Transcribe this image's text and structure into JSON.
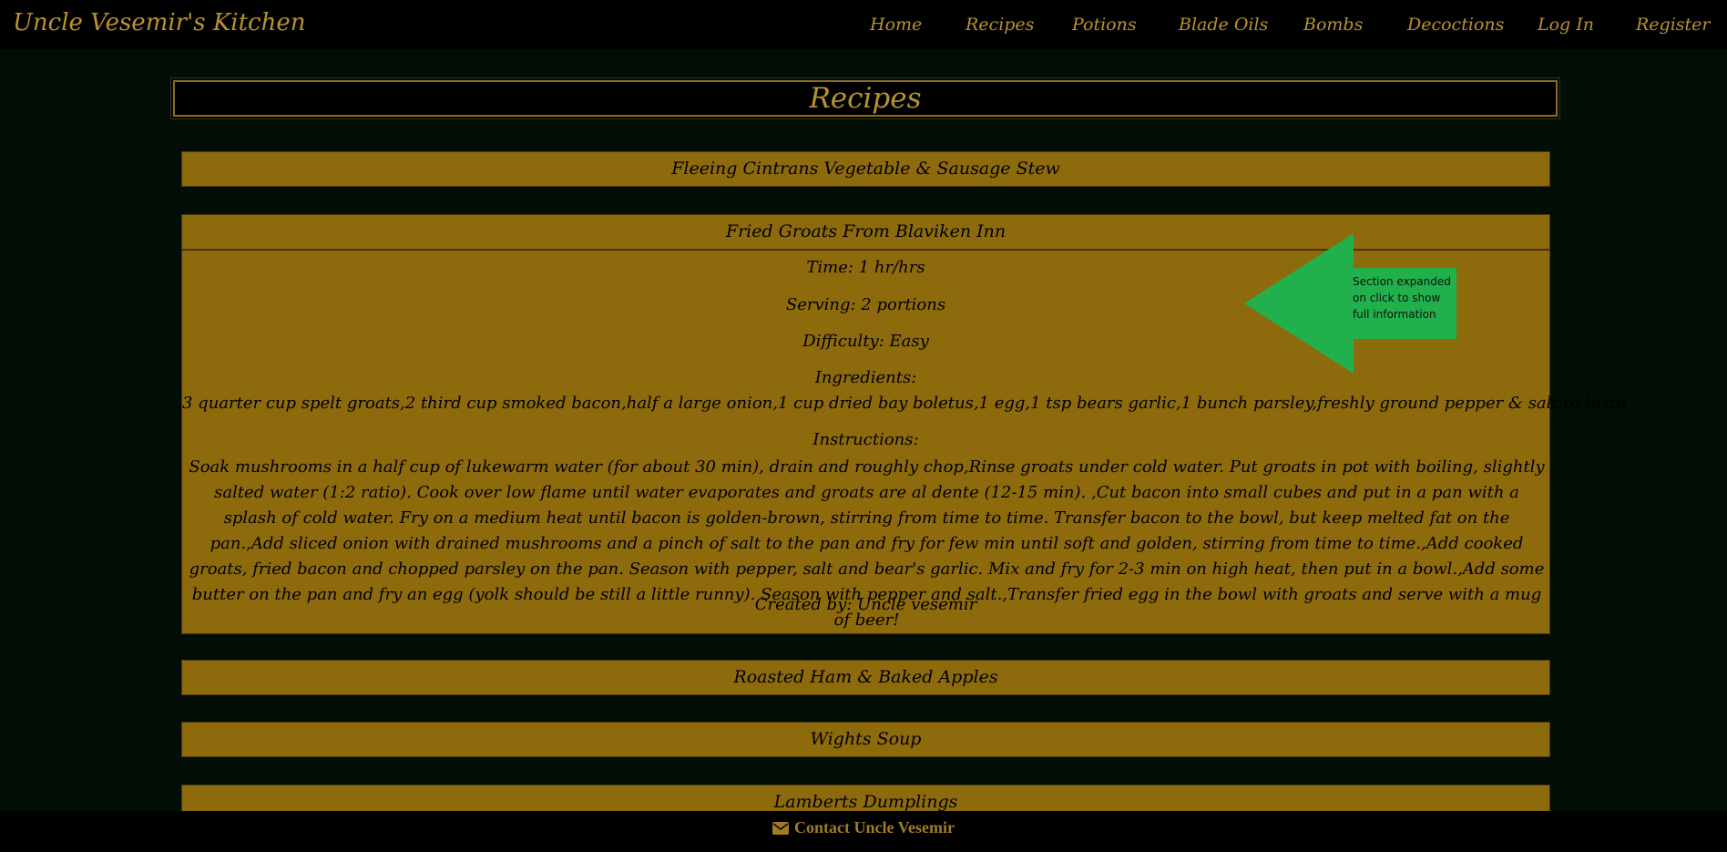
{
  "brand": "Uncle Vesemir's Kitchen",
  "nav": [
    "Home",
    "Recipes",
    "Potions",
    "Blade Oils",
    "Bombs",
    "Decoctions",
    "Log In",
    "Register"
  ],
  "page_title": "Recipes",
  "recipes": [
    "Fleeing Cintrans Vegetable & Sausage Stew",
    "Fried Groats From Blaviken Inn",
    "Roasted Ham & Baked Apples",
    "Wights Soup",
    "Lamberts Dumplings"
  ],
  "expanded": {
    "time": "Time: 1 hr/hrs",
    "serving": "Serving: 2 portions",
    "difficulty": "Difficulty: Easy",
    "ingredients_label": "Ingredients:",
    "ingredients": "3 quarter cup spelt groats,2 third cup smoked bacon,half a large onion,1 cup dried bay boletus,1 egg,1 tsp bears garlic,1 bunch parsley,freshly ground pepper & salt to taste",
    "instructions_label": "Instructions:",
    "instructions": "Soak mushrooms in a half cup of lukewarm water (for about 30 min), drain and roughly chop,Rinse groats under cold water. Put groats in pot with boiling, slightly salted water (1:2 ratio). Cook over low flame until water evaporates and groats are al dente (12-15 min). ,Cut bacon into small cubes and put in a pan with a splash of cold water. Fry on a medium heat until bacon is golden-brown, stirring from time to time. Transfer bacon to the bowl, but keep melted fat on the pan.,Add sliced onion with drained mushrooms and a pinch of salt to the pan and fry for few min until soft and golden, stirring from time to time.,Add cooked groats, fried bacon and chopped parsley on the pan. Season with pepper, salt and bear's garlic. Mix and fry for 2-3 min on high heat, then put in a bowl.,Add some butter on the pan and fry an egg (yolk should be still a little runny). Season with pepper and salt.,Transfer fried egg in the bowl with groats and serve with a mug of beer!",
    "created_by": "Created by: Uncle vesemir"
  },
  "annotation": "Section expanded on click to show full information",
  "footer": {
    "icon": "envelope-icon",
    "label": "Contact Uncle Vesemir"
  },
  "colors": {
    "nav_text": "#b8922e",
    "recipe_bg": "#8d6a0c",
    "annotation_green": "#21b04b",
    "page_bg": "#020d06"
  }
}
